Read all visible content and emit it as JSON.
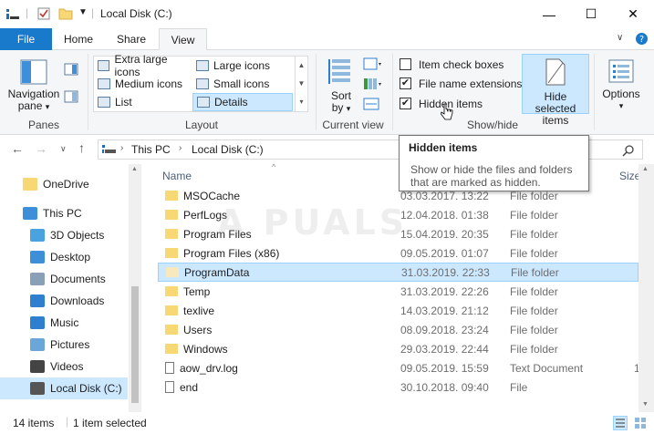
{
  "window": {
    "title": "Local Disk (C:)",
    "minimize": "—",
    "maximize": "☐",
    "close": "✕"
  },
  "ribbon_tabs": [
    "File",
    "Home",
    "Share",
    "View"
  ],
  "ribbon": {
    "panes_group": {
      "navigation_pane_line1": "Navigation",
      "navigation_pane_line2": "pane",
      "label": "Panes"
    },
    "layout_group": {
      "items": [
        "Extra large icons",
        "Large icons",
        "Medium icons",
        "Small icons",
        "List",
        "Details"
      ],
      "selected": "Details",
      "label": "Layout"
    },
    "current_view_group": {
      "sort_by_line1": "Sort",
      "sort_by_line2": "by",
      "label": "Current view"
    },
    "show_hide_group": {
      "item_check_boxes": "Item check boxes",
      "file_name_extensions": "File name extensions",
      "hidden_items": "Hidden items",
      "hide_selected_line1": "Hide selected",
      "hide_selected_line2": "items",
      "label": "Show/hide"
    },
    "options": {
      "line1": "Options"
    }
  },
  "address": {
    "crumbs": [
      "This PC",
      "Local Disk (C:)"
    ]
  },
  "nav_pane": [
    {
      "label": "OneDrive",
      "icon": "folder-icon",
      "color": "#f8d775"
    },
    {
      "label": "This PC",
      "icon": "computer-icon",
      "color": "#3c8fd8"
    },
    {
      "label": "3D Objects",
      "icon": "cube-icon",
      "color": "#4aa3df"
    },
    {
      "label": "Desktop",
      "icon": "desktop-icon",
      "color": "#3c8fd8"
    },
    {
      "label": "Documents",
      "icon": "document-icon",
      "color": "#8aa0b6"
    },
    {
      "label": "Downloads",
      "icon": "download-icon",
      "color": "#2f7fd0"
    },
    {
      "label": "Music",
      "icon": "music-icon",
      "color": "#2f7fd0"
    },
    {
      "label": "Pictures",
      "icon": "picture-icon",
      "color": "#6aa7d8"
    },
    {
      "label": "Videos",
      "icon": "video-icon",
      "color": "#444"
    },
    {
      "label": "Local Disk (C:)",
      "icon": "drive-icon",
      "color": "#555"
    }
  ],
  "columns": {
    "name": "Name",
    "size": "Size"
  },
  "files": [
    {
      "name": "MSOCache",
      "date": "03.03.2017. 13:22",
      "type": "File folder",
      "size": "",
      "kind": "folder"
    },
    {
      "name": "PerfLogs",
      "date": "12.04.2018. 01:38",
      "type": "File folder",
      "size": "",
      "kind": "folder"
    },
    {
      "name": "Program Files",
      "date": "15.04.2019. 20:35",
      "type": "File folder",
      "size": "",
      "kind": "folder"
    },
    {
      "name": "Program Files (x86)",
      "date": "09.05.2019. 01:07",
      "type": "File folder",
      "size": "",
      "kind": "folder"
    },
    {
      "name": "ProgramData",
      "date": "31.03.2019. 22:33",
      "type": "File folder",
      "size": "",
      "kind": "folder-hidden"
    },
    {
      "name": "Temp",
      "date": "31.03.2019. 22:26",
      "type": "File folder",
      "size": "",
      "kind": "folder"
    },
    {
      "name": "texlive",
      "date": "14.03.2019. 21:12",
      "type": "File folder",
      "size": "",
      "kind": "folder"
    },
    {
      "name": "Users",
      "date": "08.09.2018. 23:24",
      "type": "File folder",
      "size": "",
      "kind": "folder"
    },
    {
      "name": "Windows",
      "date": "29.03.2019. 22:44",
      "type": "File folder",
      "size": "",
      "kind": "folder"
    },
    {
      "name": "aow_drv.log",
      "date": "09.05.2019. 15:59",
      "type": "Text Document",
      "size": "1",
      "kind": "text"
    },
    {
      "name": "end",
      "date": "30.10.2018. 09:40",
      "type": "File",
      "size": "",
      "kind": "file"
    }
  ],
  "selected_file": "ProgramData",
  "status": {
    "count": "14 items",
    "selected": "1 item selected"
  },
  "tooltip": {
    "title": "Hidden items",
    "body_line1": "Show or hide the files and folders",
    "body_line2": "that are marked as hidden."
  },
  "watermark": "A  PUALS",
  "colors": {
    "accent": "#1979ca",
    "selection": "#cce8ff",
    "folder": "#f8d775"
  }
}
